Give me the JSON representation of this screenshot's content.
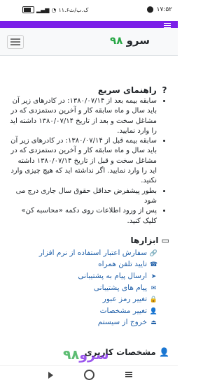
{
  "status_bar": {
    "time": "۱۷:۵۲",
    "data_rate": "۱۱.۶ک.ب/ث"
  },
  "header": {
    "brand_word": "سرو",
    "brand_num": "۹۸"
  },
  "guide": {
    "icon": "question-icon",
    "title": "راهنمای سریع",
    "items": [
      "سابقه بیمه بعد از ۱۳۸۰/۰۷/۱۴: در کادرهای زیر آن باید سال و ماه سابقه کار و آخرین دستمزدی که در مشاغل سخت و بعد از تاریخ ۱۳۸۰/۰۷/۱۴ داشته اید را وارد نمایید.",
      "سابقه بیمه قبل از ۱۳۸۰/۰۷/۱۴: در کادرهای زیر آن باید سال و ماه سابقه کار و آخرین دستمزدی که در مشاغل سخت و قبل از تاریخ ۱۳۸۰/۰۷/۱۴ داشته اید را وارد نمایید. اگر نداشته اید که هیچ چیزی وارد نکنید.",
      "بطور پیشفرض حداقل حقوق سال جاری درج می شود",
      "پس از ورود اطلاعات روی دکمه «محاسبه کن» کلیک کنید."
    ]
  },
  "tools": {
    "title": "ابزارها",
    "items": [
      {
        "label": "سفارش اعتبار استفاده از نرم افزار",
        "icon": "link-icon",
        "glyph": "🔗"
      },
      {
        "label": "تایید تلفن همراه",
        "icon": "phone-icon",
        "glyph": "☎"
      },
      {
        "label": "ارسال پیام به پشتیبانی",
        "icon": "send-icon",
        "glyph": "➤"
      },
      {
        "label": "پیام های پشتیبانی",
        "icon": "envelope-icon",
        "glyph": "✉"
      },
      {
        "label": "تغییر رمز عبور",
        "icon": "lock-icon",
        "glyph": "🔒"
      },
      {
        "label": "تغییر مشخصات",
        "icon": "user-icon",
        "glyph": "👤"
      },
      {
        "label": "خروج از سیستم",
        "icon": "logout-icon",
        "glyph": "⏏"
      }
    ]
  },
  "user_section": {
    "title": "مشخصات کاربری"
  },
  "watermark": {
    "word": "سرو",
    "num": "۹۸"
  },
  "colors": {
    "accent": "#7b1fe8",
    "brand_green": "#28a745",
    "link": "#1f5fa8"
  }
}
